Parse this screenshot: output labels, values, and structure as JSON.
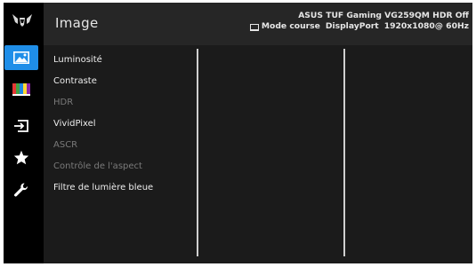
{
  "header": {
    "title": "Image",
    "monitor_model": "ASUS TUF Gaming  VG259QM HDR Off",
    "mode": "Mode course",
    "input": "DisplayPort",
    "resolution": "1920x1080@ 60Hz"
  },
  "sidebar": {
    "logo": "tuf-gaming-logo",
    "items": [
      {
        "icon": "image-icon",
        "active": true
      },
      {
        "icon": "color-bars-icon",
        "active": false
      },
      {
        "icon": "input-select-icon",
        "active": false
      },
      {
        "icon": "star-icon",
        "active": false
      },
      {
        "icon": "wrench-icon",
        "active": false
      }
    ]
  },
  "menu": {
    "items": [
      {
        "label": "Luminosité",
        "enabled": true
      },
      {
        "label": "Contraste",
        "enabled": true
      },
      {
        "label": "HDR",
        "enabled": false
      },
      {
        "label": "VividPixel",
        "enabled": true
      },
      {
        "label": "ASCR",
        "enabled": false
      },
      {
        "label": "Contrôle de l'aspect",
        "enabled": false
      },
      {
        "label": "Filtre de lumière bleue",
        "enabled": true
      }
    ]
  },
  "colors": {
    "accent": "#1f8ee8",
    "background": "#1b1b1b",
    "header": "#262626",
    "sidebar": "#000000"
  }
}
